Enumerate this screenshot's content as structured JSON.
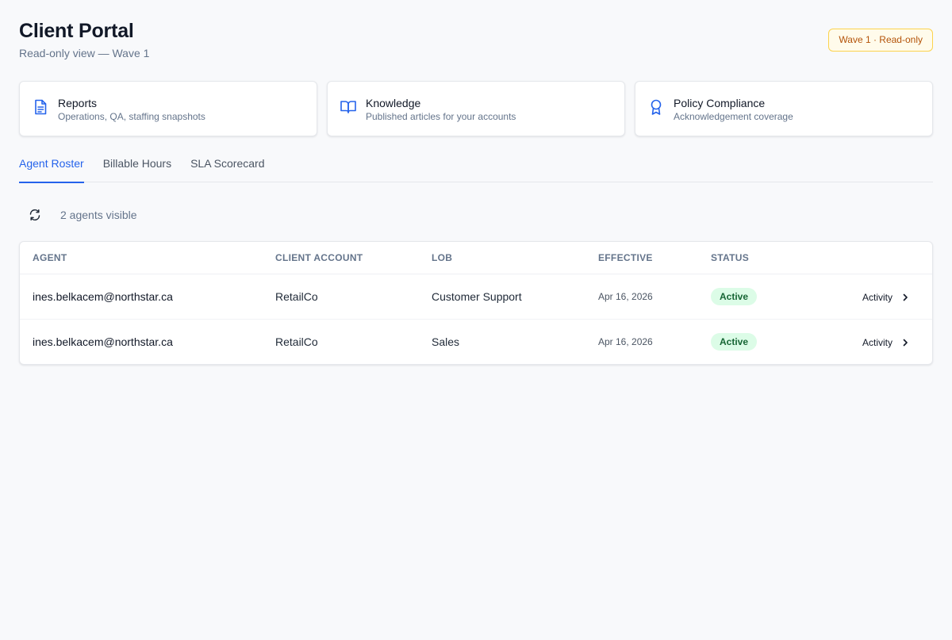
{
  "header": {
    "title": "Client Portal",
    "subtitle": "Read-only view — Wave 1",
    "badge": "Wave 1 · Read-only"
  },
  "cards": [
    {
      "title": "Reports",
      "description": "Operations, QA, staffing snapshots",
      "icon": "document-icon"
    },
    {
      "title": "Knowledge",
      "description": "Published articles for your accounts",
      "icon": "book-open-icon"
    },
    {
      "title": "Policy Compliance",
      "description": "Acknowledgement coverage",
      "icon": "award-ribbon-icon"
    }
  ],
  "tabs": [
    {
      "label": "Agent Roster",
      "active": true
    },
    {
      "label": "Billable Hours",
      "active": false
    },
    {
      "label": "SLA Scorecard",
      "active": false
    }
  ],
  "toolbar": {
    "refresh_icon": "refresh-icon",
    "count_text": "2 agents visible"
  },
  "table": {
    "columns": [
      "AGENT",
      "CLIENT ACCOUNT",
      "LOB",
      "EFFECTIVE",
      "STATUS"
    ],
    "rows": [
      {
        "agent": "ines.belkacem@northstar.ca",
        "client_account": "RetailCo",
        "lob": "Customer Support",
        "effective": "Apr 16, 2026",
        "status": "Active",
        "action": "Activity"
      },
      {
        "agent": "ines.belkacem@northstar.ca",
        "client_account": "RetailCo",
        "lob": "Sales",
        "effective": "Apr 16, 2026",
        "status": "Active",
        "action": "Activity"
      }
    ]
  },
  "colors": {
    "accent": "#2563eb",
    "icon_blue": "#2563eb",
    "badge_bg": "#fffbeb",
    "badge_text": "#b45309",
    "status_bg": "#dcfce7",
    "status_text": "#166534"
  }
}
